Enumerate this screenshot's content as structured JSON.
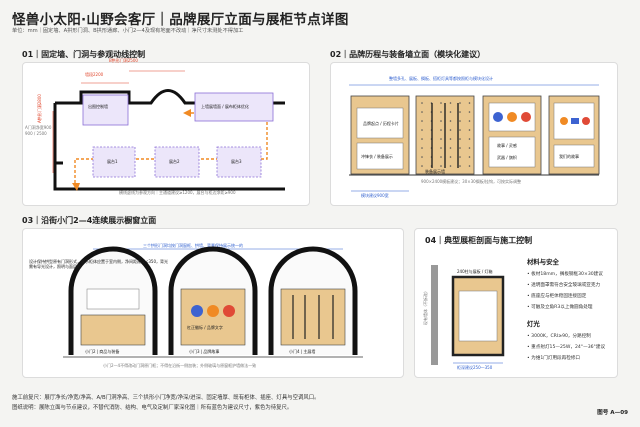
{
  "header": {
    "title": "怪兽小太阳·山野会客厅｜品牌展厅立面与展柜节点详图",
    "subtitle": "单位：mm｜固定墙、A拱形门洞、B拱形通廊、小门2—4及现有地面不改动｜净尺寸未测处不得加工"
  },
  "section1": {
    "title": "01｜固定墙、门洞与参观动线控制",
    "dim_opening": "B拱形门洞2500",
    "dim_width": "墙段2200",
    "dim_height": "A拱形门洞2800",
    "left_label": "A门洞净宽900\n900 / 2500",
    "boxes": [
      "出图控制墙",
      "上墙展墙面 / 展布柜体优化",
      "展台1",
      "展台2",
      "展台3"
    ],
    "caption": "横线虚线为参观方向｜主通道建议≥1200，展台与柜边净距≥900"
  },
  "section2": {
    "title": "02｜品牌历程与装备墙立面（模块化建议）",
    "top_note": "整墙多孔、展板、搁板、搭柜灯具等都按照柜与模块化设计",
    "panels": [
      "品牌起点 / 历程卡片",
      "冲锋衣 / 装备展示",
      "装备展示墙",
      "故事 / 灵感",
      "武器 / 旗帜",
      "我们的故事"
    ],
    "caption": "模块建议900宽",
    "side_note": "900×2400模板建议；30×30搁板/挂钩，可按实际调整"
  },
  "section3": {
    "title": "03｜沿街小门2—4连续展示橱窗立面",
    "top_note": "三个拱形门洞均按门洞窗框、拱墙、背景保持展示统一的",
    "side_note": "设计保持拱型原有门洞形式，展示柜体应置于室内侧，净间距建议<350，背光需有导光设计，照明与面层的",
    "doors": [
      "小门2 | 商品与装备",
      "小门3 | 品牌故事",
      "小门4 | 主展墙"
    ],
    "center_card": "杠正徽标 / 品牌文字",
    "caption": "小门2—4不得改动门洞原门框；不得在沿街一侧加装；外侧玻璃与原窗框护墙做法一致"
  },
  "section4": {
    "title": "04｜典型展柜剖面与施工控制",
    "top_note": "240柱与展板 / 灯箱",
    "side_label": "现有墙体（不拆改）",
    "dim": "柜深建议250—350",
    "materials_title": "材料与安全",
    "materials": [
      "• 板材18mm，搁板钢框30×30建议",
      "• 透明面罩需符合安全玻璃或亚克力",
      "• 底座应与柜体稳固连接固定",
      "• 可触及立角R3以上做圆角处理"
    ],
    "light_title": "灯光",
    "light": [
      "• 3000K，CRI≥90，分路控制",
      "• 重点射灯15—25W，24°—36°建议",
      "• 为维1门灯用段再检修口"
    ]
  },
  "footer": {
    "note1": "施工前复尺：展厅净长/净宽/净高、A/B门洞净高、三个拱形小门净宽/净深/进深、固定墙厚、既有柜体、插座、灯具与空调风口。",
    "note2": "图纸说明：展陈立面与节点建议，不替代消防、结构、电气及定制厂家深化图｜所有蓝色为建议尺寸，紫色为待复尺。",
    "sheet": "图号 A—09"
  },
  "colors": {
    "accent_red": "#e0452b",
    "accent_blue": "#2f5fcf",
    "purple": "#8b6fd6",
    "wood": "#e9c78f",
    "blue_circle": "#3d63d1",
    "orange_circle": "#f08a24",
    "red_circle": "#e04a36",
    "yellow_circle": "#f2c12e"
  }
}
